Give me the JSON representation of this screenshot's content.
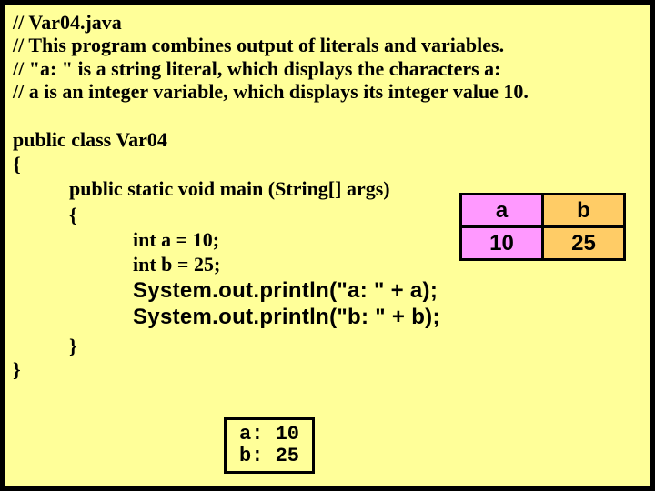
{
  "comments": {
    "l1": "// Var04.java",
    "l2": "// This program combines output of literals and variables.",
    "l3": "// \"a: \" is a string literal, which displays the characters a:",
    "l4": "// a is an integer variable, which displays its integer value 10."
  },
  "code": {
    "class_line": "public class Var04",
    "open_brace": "{",
    "main_sig": "public static void main (String[] args)",
    "main_open": "{",
    "decl_a": "int a = 10;",
    "decl_b": "int b = 25;",
    "print_a": "System.out.println(\"a: \" + a);",
    "print_b": "System.out.println(\"b: \" + b);",
    "main_close": "}",
    "class_close": "}"
  },
  "table": {
    "ha": "a",
    "hb": "b",
    "va": "10",
    "vb": "25"
  },
  "output": {
    "l1": "a: 10",
    "l2": "b: 25"
  }
}
